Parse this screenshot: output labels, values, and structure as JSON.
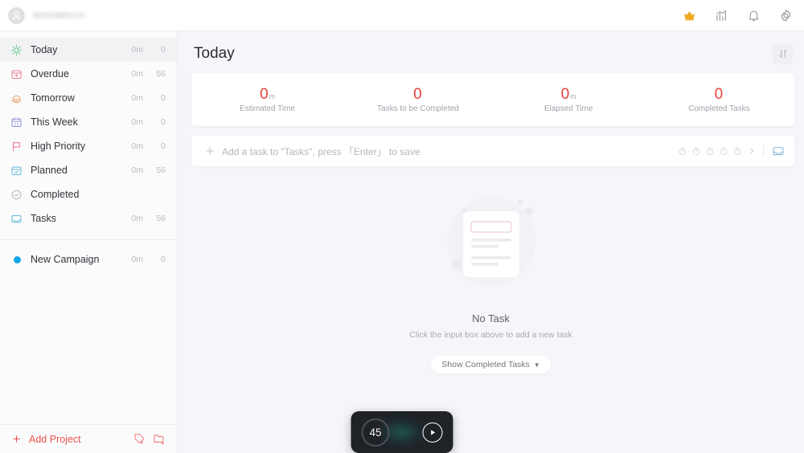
{
  "topbar": {
    "username": "",
    "avatar_icon": "user-avatar-icon",
    "icons": [
      {
        "name": "crown-icon",
        "label": "Premium"
      },
      {
        "name": "statistics-icon",
        "label": "Statistics"
      },
      {
        "name": "bell-icon",
        "label": "Notifications"
      },
      {
        "name": "gear-icon",
        "label": "Settings"
      }
    ]
  },
  "sidebar": {
    "smart_lists": [
      {
        "label": "Today",
        "icon": "sun-icon",
        "time": "0m",
        "count": "0",
        "active": true
      },
      {
        "label": "Overdue",
        "icon": "overdue-icon",
        "time": "0m",
        "count": "56",
        "active": false
      },
      {
        "label": "Tomorrow",
        "icon": "sunrise-icon",
        "time": "0m",
        "count": "0",
        "active": false
      },
      {
        "label": "This Week",
        "icon": "calendar-icon",
        "time": "0m",
        "count": "0",
        "active": false
      },
      {
        "label": "High Priority",
        "icon": "flag-icon",
        "time": "0m",
        "count": "0",
        "active": false
      },
      {
        "label": "Planned",
        "icon": "planned-icon",
        "time": "0m",
        "count": "56",
        "active": false
      },
      {
        "label": "Completed",
        "icon": "check-circle-icon",
        "time": "",
        "count": "",
        "active": false
      },
      {
        "label": "Tasks",
        "icon": "inbox-icon",
        "time": "0m",
        "count": "56",
        "active": false
      }
    ],
    "projects": [
      {
        "label": "New Campaign",
        "color": "#12a8e8",
        "time": "0m",
        "count": "0"
      }
    ],
    "footer": {
      "add_project_label": "Add Project",
      "add_project_color": "#e8534e",
      "icons": [
        {
          "name": "add-tag-icon"
        },
        {
          "name": "add-folder-icon"
        }
      ]
    }
  },
  "main": {
    "page_title": "Today",
    "sort_button": "sort-icon",
    "stats": [
      {
        "value": "0",
        "unit": "m",
        "label": "Estimated Time"
      },
      {
        "value": "0",
        "unit": "",
        "label": "Tasks to be Completed"
      },
      {
        "value": "0",
        "unit": "m",
        "label": "Elapsed Time"
      },
      {
        "value": "0",
        "unit": "",
        "label": "Completed Tasks"
      }
    ],
    "stat_color": "#e8403c",
    "add_task": {
      "placeholder": "Add a task to \"Tasks\", press 「Enter」 to save",
      "value": "",
      "plus_icon": "plus-icon",
      "priority_icons": [
        "priority-1-icon",
        "priority-2-icon",
        "priority-3-icon",
        "priority-4-icon",
        "priority-5-icon"
      ],
      "more_icon": "chevron-right-icon",
      "list_icon": "inbox-icon"
    },
    "empty_state": {
      "title": "No Task",
      "subtitle": "Click the input box above to add a new task",
      "button_label": "Show Completed Tasks",
      "button_caret": "▼",
      "illustration": "empty-document-illustration"
    }
  },
  "timer": {
    "minutes": "45",
    "play_icon": "play-icon"
  }
}
